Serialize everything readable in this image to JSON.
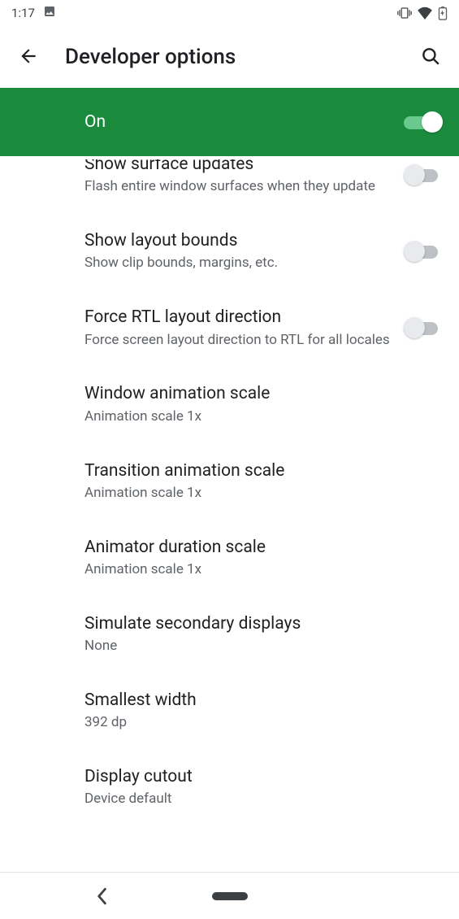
{
  "status": {
    "time": "1:17"
  },
  "header": {
    "title": "Developer options"
  },
  "master": {
    "label": "On",
    "enabled": true
  },
  "rows": [
    {
      "title": "Show surface updates",
      "subtitle": "Flash entire window surfaces when they update",
      "toggle": "off"
    },
    {
      "title": "Show layout bounds",
      "subtitle": "Show clip bounds, margins, etc.",
      "toggle": "off"
    },
    {
      "title": "Force RTL layout direction",
      "subtitle": "Force screen layout direction to RTL for all locales",
      "toggle": "off"
    },
    {
      "title": "Window animation scale",
      "subtitle": "Animation scale 1x",
      "toggle": null
    },
    {
      "title": "Transition animation scale",
      "subtitle": "Animation scale 1x",
      "toggle": null
    },
    {
      "title": "Animator duration scale",
      "subtitle": "Animation scale 1x",
      "toggle": null
    },
    {
      "title": "Simulate secondary displays",
      "subtitle": "None",
      "toggle": null
    },
    {
      "title": "Smallest width",
      "subtitle": "392 dp",
      "toggle": null
    },
    {
      "title": "Display cutout",
      "subtitle": "Device default",
      "toggle": null
    }
  ]
}
